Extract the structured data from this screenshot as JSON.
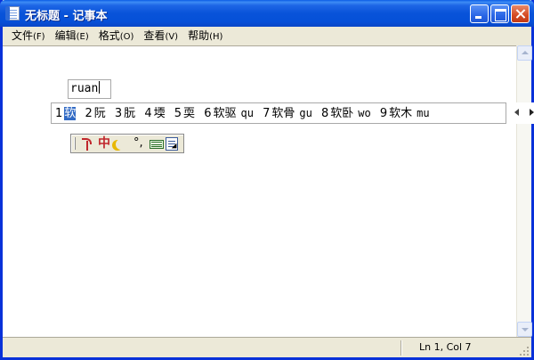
{
  "window": {
    "title": "无标题 - 记事本"
  },
  "menu": {
    "items": [
      {
        "label": "文件",
        "accel": "(F)"
      },
      {
        "label": "编辑",
        "accel": "(E)"
      },
      {
        "label": "格式",
        "accel": "(O)"
      },
      {
        "label": "查看",
        "accel": "(V)"
      },
      {
        "label": "帮助",
        "accel": "(H)"
      }
    ]
  },
  "ime": {
    "composition": "ruan",
    "candidates": [
      {
        "num": "1",
        "word": "软",
        "pinyin": "",
        "selected": true
      },
      {
        "num": "2",
        "word": "阮",
        "pinyin": ""
      },
      {
        "num": "3",
        "word": "朊",
        "pinyin": ""
      },
      {
        "num": "4",
        "word": "堧",
        "pinyin": ""
      },
      {
        "num": "5",
        "word": "耎",
        "pinyin": ""
      },
      {
        "num": "6",
        "word": "软驱",
        "pinyin": "qu"
      },
      {
        "num": "7",
        "word": "软骨",
        "pinyin": "gu"
      },
      {
        "num": "8",
        "word": "软卧",
        "pinyin": "wo"
      },
      {
        "num": "9",
        "word": "软木",
        "pinyin": "mu"
      }
    ],
    "status_bar": {
      "mode": "中",
      "punct": "°,"
    }
  },
  "statusbar": {
    "position": "Ln 1, Col 7"
  },
  "colors": {
    "title_blue": "#0853d9",
    "selection": "#316ac5",
    "chrome": "#ece9d8"
  }
}
